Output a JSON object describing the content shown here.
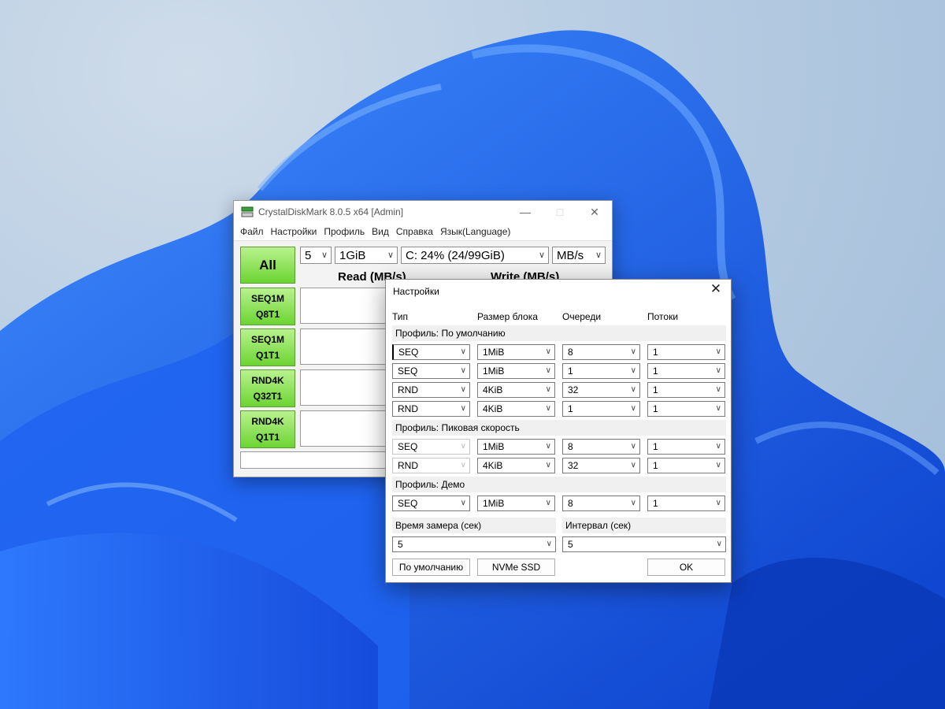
{
  "main_window": {
    "title": "CrystalDiskMark 8.0.5 x64 [Admin]",
    "menu": [
      "Файл",
      "Настройки",
      "Профиль",
      "Вид",
      "Справка",
      "Язык(Language)"
    ],
    "toolbar": {
      "count": "5",
      "size": "1GiB",
      "drive": "C: 24% (24/99GiB)",
      "unit": "MB/s"
    },
    "all_label": "All",
    "col_read": "Read (MB/s)",
    "col_write": "Write (MB/s)",
    "tests": [
      {
        "line1": "SEQ1M",
        "line2": "Q8T1"
      },
      {
        "line1": "SEQ1M",
        "line2": "Q1T1"
      },
      {
        "line1": "RND4K",
        "line2": "Q32T1"
      },
      {
        "line1": "RND4K",
        "line2": "Q1T1"
      }
    ]
  },
  "settings": {
    "title": "Настройки",
    "headers": {
      "type": "Тип",
      "block": "Размер блока",
      "queues": "Очереди",
      "threads": "Потоки"
    },
    "profile_default": "Профиль: По умолчанию",
    "default_rows": [
      {
        "type": "SEQ",
        "block": "1MiB",
        "queue": "8",
        "threads": "1"
      },
      {
        "type": "SEQ",
        "block": "1MiB",
        "queue": "1",
        "threads": "1"
      },
      {
        "type": "RND",
        "block": "4KiB",
        "queue": "32",
        "threads": "1"
      },
      {
        "type": "RND",
        "block": "4KiB",
        "queue": "1",
        "threads": "1"
      }
    ],
    "profile_peak": "Профиль: Пиковая скорость",
    "peak_rows": [
      {
        "type": "SEQ",
        "block": "1MiB",
        "queue": "8",
        "threads": "1"
      },
      {
        "type": "RND",
        "block": "4KiB",
        "queue": "32",
        "threads": "1"
      }
    ],
    "profile_demo": "Профиль: Демо",
    "demo_rows": [
      {
        "type": "SEQ",
        "block": "1MiB",
        "queue": "8",
        "threads": "1"
      }
    ],
    "measure_time_label": "Время замера (сек)",
    "measure_time": "5",
    "interval_label": "Интервал (сек)",
    "interval": "5",
    "buttons": {
      "default": "По умолчанию",
      "nvme": "NVMe SSD",
      "ok": "OK"
    }
  },
  "colors": {
    "accent_green": "#6cd433",
    "wallpaper_blue": "#1a5ee8"
  }
}
